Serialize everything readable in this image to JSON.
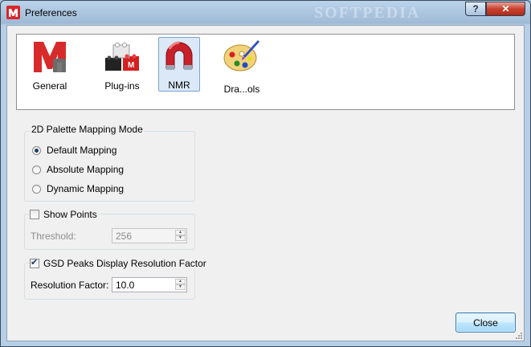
{
  "window": {
    "title": "Preferences",
    "watermark": "SOFTPEDIA",
    "help_label": "?",
    "close_label": "✕"
  },
  "categories": [
    {
      "label": "General",
      "icon": "mnova-m-icon"
    },
    {
      "label": "Plug-ins",
      "icon": "plugin-blocks-icon"
    },
    {
      "label": "NMR",
      "icon": "magnet-icon",
      "selected": true
    },
    {
      "label": "Dra...ols",
      "icon": "palette-icon"
    }
  ],
  "palette_group": {
    "title": "2D Palette Mapping Mode",
    "options": [
      {
        "label": "Default Mapping",
        "selected": true
      },
      {
        "label": "Absolute Mapping",
        "selected": false
      },
      {
        "label": "Dynamic Mapping",
        "selected": false
      }
    ]
  },
  "show_points": {
    "label": "Show Points",
    "checked": false,
    "threshold_label": "Threshold:",
    "threshold_value": "256"
  },
  "gsd": {
    "label": "GSD Peaks Display Resolution Factor",
    "checked": true,
    "factor_label": "Resolution Factor:",
    "factor_value": "10.0"
  },
  "buttons": {
    "close": "Close"
  },
  "colors": {
    "accent": "#3c7fb1",
    "title_bar": "#b7cfe6",
    "dialog_bg": "#f0f0f0"
  }
}
